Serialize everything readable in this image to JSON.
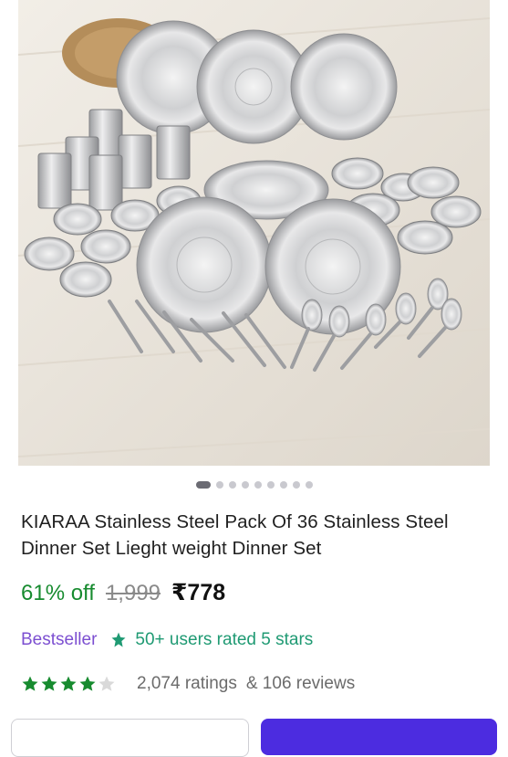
{
  "product": {
    "title": "KIARAA Stainless Steel Pack Of 36 Stainless Steel Dinner Set Lieght weight Dinner Set",
    "discount": "61% off",
    "mrp": "1,999",
    "price": "₹778"
  },
  "carousel": {
    "total": 9,
    "active_index": 0
  },
  "badges": {
    "bestseller": "Bestseller",
    "rated": "50+ users rated 5 stars"
  },
  "rating": {
    "stars_filled": 4,
    "stars_total": 5,
    "ratings": "2,074 ratings",
    "reviews": "& 106 reviews"
  },
  "colors": {
    "discount": "#178b2f",
    "bestseller": "#7c4fd1",
    "rated": "#1f9a73",
    "star": "#178b2f",
    "primary_button": "#4c2ce0"
  }
}
